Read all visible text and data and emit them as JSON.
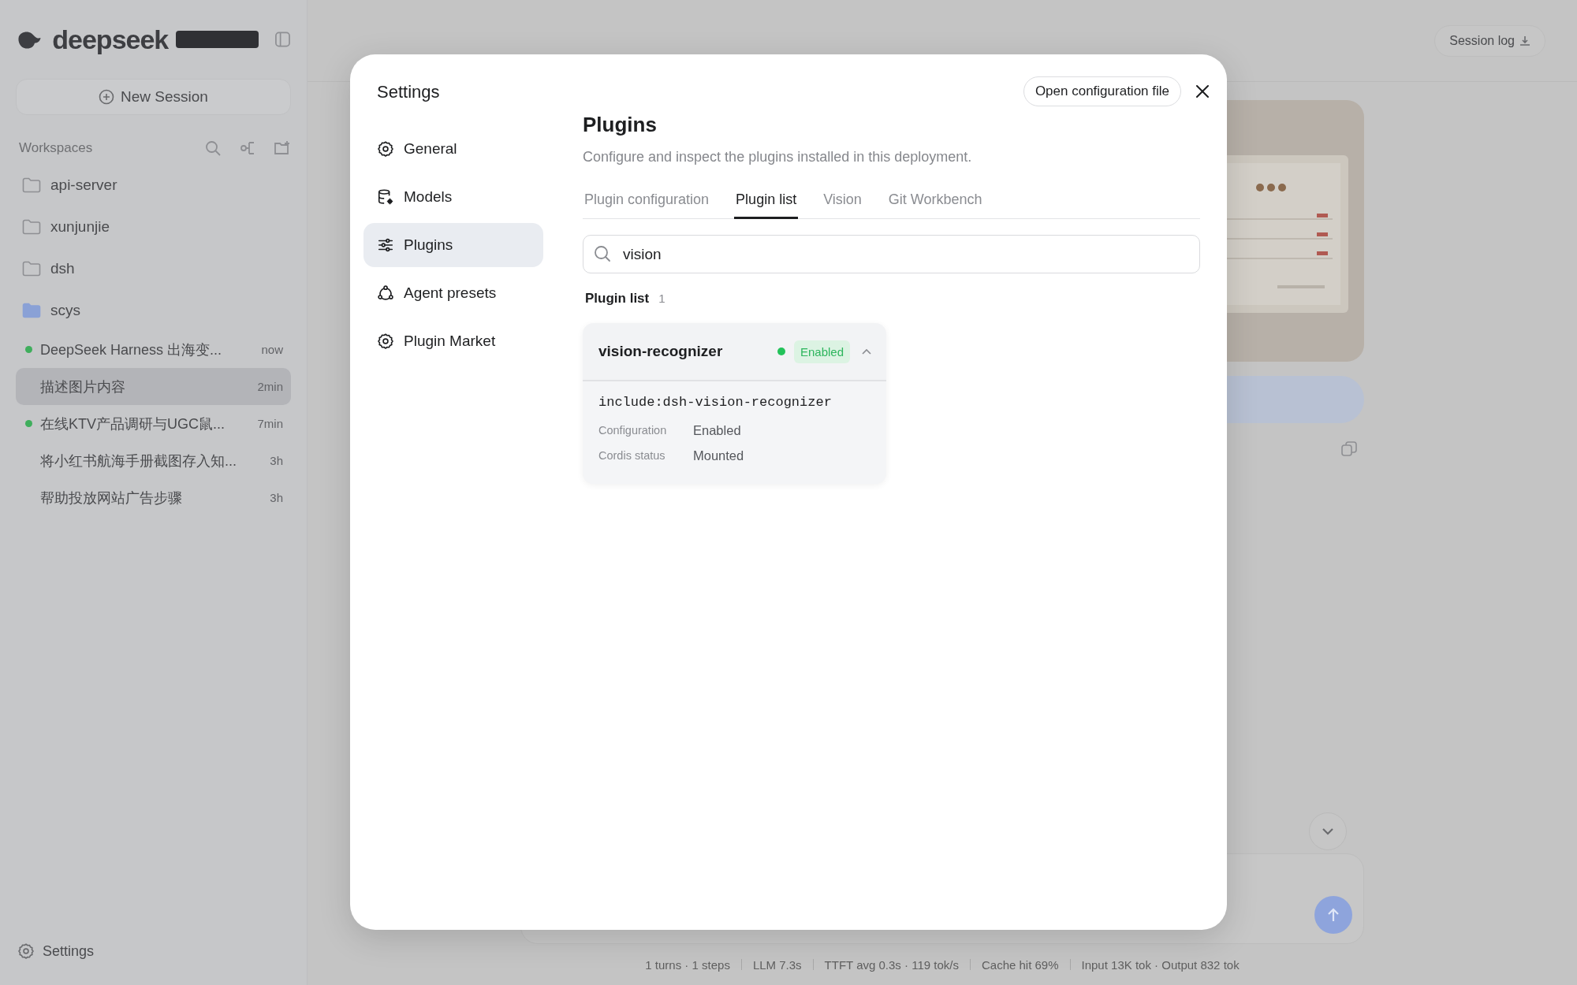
{
  "sidebar": {
    "brand": "deepseek",
    "new_session": "New Session",
    "section_title": "Workspaces",
    "workspaces": [
      {
        "name": "api-server",
        "selected": false
      },
      {
        "name": "xunjunjie",
        "selected": false
      },
      {
        "name": "dsh",
        "selected": false
      },
      {
        "name": "scys",
        "selected": true
      }
    ],
    "sessions": [
      {
        "title": "DeepSeek Harness 出海变...",
        "time": "now",
        "active": true,
        "selected": false
      },
      {
        "title": "描述图片内容",
        "time": "2min",
        "active": false,
        "selected": true
      },
      {
        "title": "在线KTV产品调研与UGC鼠...",
        "time": "7min",
        "active": true,
        "selected": false
      },
      {
        "title": "将小红书航海手册截图存入知...",
        "time": "3h",
        "active": false,
        "selected": false
      },
      {
        "title": "帮助投放网站广告步骤",
        "time": "3h",
        "active": false,
        "selected": false
      }
    ],
    "settings": "Settings"
  },
  "header": {
    "session_log": "Session log"
  },
  "status_bar": [
    "1 turns · 1 steps",
    "LLM 7.3s",
    "TTFT avg 0.3s · 119 tok/s",
    "Cache hit 69%",
    "Input 13K tok · Output 832 tok"
  ],
  "settings_dialog": {
    "title": "Settings",
    "open_config": "Open configuration file",
    "nav": [
      {
        "label": "General",
        "selected": false
      },
      {
        "label": "Models",
        "selected": false
      },
      {
        "label": "Plugins",
        "selected": true
      },
      {
        "label": "Agent presets",
        "selected": false
      },
      {
        "label": "Plugin Market",
        "selected": false
      }
    ],
    "page": {
      "title": "Plugins",
      "description": "Configure and inspect the plugins installed in this deployment.",
      "tabs": [
        {
          "label": "Plugin configuration",
          "selected": false
        },
        {
          "label": "Plugin list",
          "selected": true
        },
        {
          "label": "Vision",
          "selected": false
        },
        {
          "label": "Git Workbench",
          "selected": false
        }
      ],
      "search": {
        "value": "vision"
      },
      "list_title": "Plugin list",
      "list_count": "1",
      "plugins": [
        {
          "name": "vision-recognizer",
          "status": "Enabled",
          "expanded": true,
          "source": "include:dsh-vision-recognizer",
          "details": [
            {
              "label": "Configuration",
              "value": "Enabled"
            },
            {
              "label": "Cordis status",
              "value": "Mounted"
            }
          ]
        }
      ]
    }
  }
}
